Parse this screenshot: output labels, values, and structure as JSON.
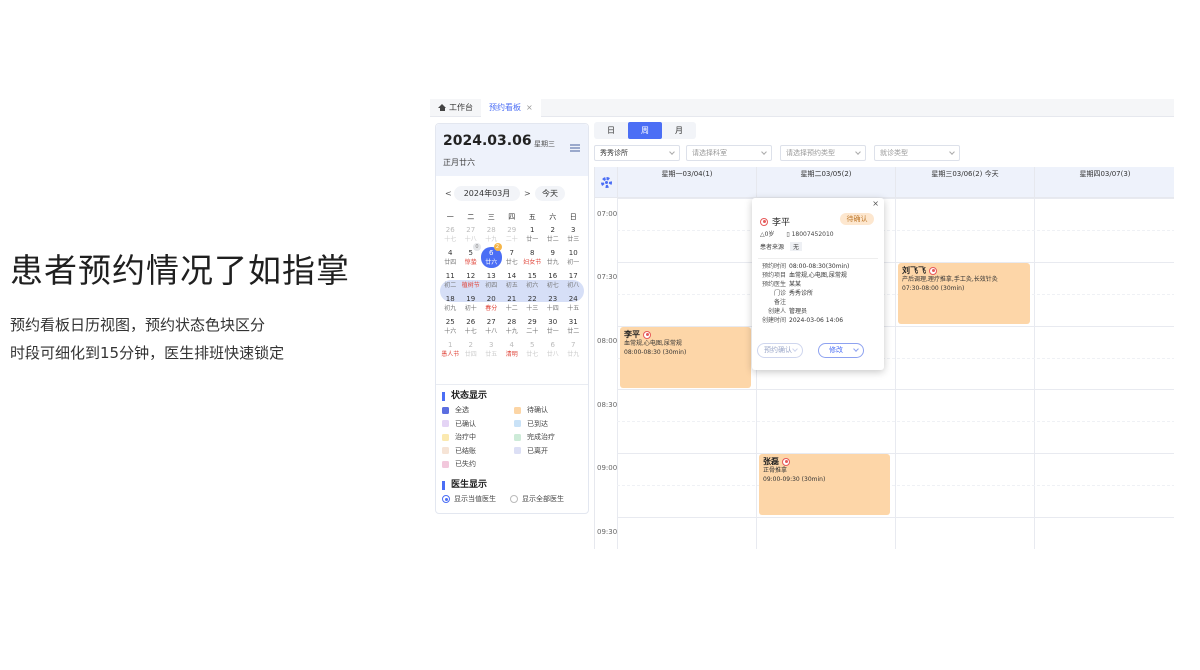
{
  "hero": {
    "title": "患者预约情况了如指掌",
    "line1": "预约看板日历视图，预约状态色块区分",
    "line2": "时段可细化到15分钟，医生排班快速锁定"
  },
  "tabs": [
    {
      "label": "工作台",
      "icon": "home-icon"
    },
    {
      "label": "预约看板",
      "close": "×"
    }
  ],
  "side": {
    "date": "2024.03.06",
    "weekday": "星期三",
    "lunar": "正月廿六",
    "month": "2024年03月",
    "prev": "<",
    "next": ">",
    "today": "今天",
    "week_heads": [
      "一",
      "二",
      "三",
      "四",
      "五",
      "六",
      "日"
    ],
    "weeks": [
      [
        {
          "n": "26",
          "s": "十七",
          "dim": true
        },
        {
          "n": "27",
          "s": "十八",
          "dim": true
        },
        {
          "n": "28",
          "s": "十九",
          "dim": true
        },
        {
          "n": "29",
          "s": "二十",
          "dim": true
        },
        {
          "n": "1",
          "s": "廿一"
        },
        {
          "n": "2",
          "s": "廿二"
        },
        {
          "n": "3",
          "s": "廿三"
        }
      ],
      [
        {
          "n": "4",
          "s": "廿四"
        },
        {
          "n": "5",
          "s": "惊蛰",
          "red": true,
          "badge": "0"
        },
        {
          "n": "6",
          "s": "廿六",
          "selected": true,
          "badge": "2"
        },
        {
          "n": "7",
          "s": "廿七"
        },
        {
          "n": "8",
          "s": "妇女节",
          "red": true
        },
        {
          "n": "9",
          "s": "廿九"
        },
        {
          "n": "10",
          "s": "初一"
        }
      ],
      [
        {
          "n": "11",
          "s": "初二"
        },
        {
          "n": "12",
          "s": "植树节",
          "red": true
        },
        {
          "n": "13",
          "s": "初四"
        },
        {
          "n": "14",
          "s": "初五"
        },
        {
          "n": "15",
          "s": "初六"
        },
        {
          "n": "16",
          "s": "初七"
        },
        {
          "n": "17",
          "s": "初八"
        }
      ],
      [
        {
          "n": "18",
          "s": "初九"
        },
        {
          "n": "19",
          "s": "初十"
        },
        {
          "n": "20",
          "s": "春分",
          "red": true
        },
        {
          "n": "21",
          "s": "十二"
        },
        {
          "n": "22",
          "s": "十三"
        },
        {
          "n": "23",
          "s": "十四"
        },
        {
          "n": "24",
          "s": "十五"
        }
      ],
      [
        {
          "n": "25",
          "s": "十六"
        },
        {
          "n": "26",
          "s": "十七"
        },
        {
          "n": "27",
          "s": "十八"
        },
        {
          "n": "28",
          "s": "十九"
        },
        {
          "n": "29",
          "s": "二十"
        },
        {
          "n": "30",
          "s": "廿一"
        },
        {
          "n": "31",
          "s": "廿二"
        }
      ],
      [
        {
          "n": "1",
          "s": "愚人节",
          "dim": true,
          "red": true
        },
        {
          "n": "2",
          "s": "廿四",
          "dim": true
        },
        {
          "n": "3",
          "s": "廿五",
          "dim": true
        },
        {
          "n": "4",
          "s": "清明",
          "dim": true,
          "red": true
        },
        {
          "n": "5",
          "s": "廿七",
          "dim": true
        },
        {
          "n": "6",
          "s": "廿八",
          "dim": true
        },
        {
          "n": "7",
          "s": "廿九",
          "dim": true
        }
      ]
    ],
    "status_title": "状态显示",
    "statuses": [
      {
        "label": "全选",
        "color": "#5b6ee0"
      },
      {
        "label": "待确认",
        "color": "#fcd5a5"
      },
      {
        "label": "已确认",
        "color": "#e4d4f5"
      },
      {
        "label": "已到达",
        "color": "#c9e2f7"
      },
      {
        "label": "治疗中",
        "color": "#fbe9b0"
      },
      {
        "label": "完成治疗",
        "color": "#cdebd8"
      },
      {
        "label": "已结账",
        "color": "#f6e4d6"
      },
      {
        "label": "已离开",
        "color": "#dcdff5"
      },
      {
        "label": "已失约",
        "color": "#f2c8dc"
      }
    ],
    "doctor_title": "医生显示",
    "doctor_opts": [
      "显示当值医生",
      "显示全部医生"
    ]
  },
  "views": [
    "日",
    "周",
    "月"
  ],
  "filters": {
    "clinic": "秀秀诊所",
    "dept": "请选择科室",
    "type": "请选择预约类型",
    "visit": "就诊类型"
  },
  "week": {
    "days": [
      "星期一03/04(1)",
      "星期二03/05(2)",
      "星期三03/06(2) 今天",
      "星期四03/07(3)"
    ],
    "times": [
      "07:00",
      "07:30",
      "08:00",
      "08:30",
      "09:00",
      "09:30"
    ]
  },
  "appointments": [
    {
      "name": "李平",
      "desc": "血常规,心电图,尿常规",
      "time": "08:00-08:30 (30min)"
    },
    {
      "name": "刘飞飞",
      "desc": "产后调理,理疗推拿,手工灸,长效针灸",
      "time": "07:30-08:00 (30min)"
    },
    {
      "name": "张磊",
      "desc": "正骨推拿",
      "time": "09:00-09:30 (30min)"
    }
  ],
  "popup": {
    "close": "×",
    "name": "李平",
    "status": "待确认",
    "age": "△0岁",
    "phone": "18007452010",
    "source_label": "患者来源",
    "source": "无",
    "fields": [
      {
        "k": "预约时间",
        "v": "08:00-08:30(30min)"
      },
      {
        "k": "预约项目",
        "v": "血常规,心电图,尿常规"
      },
      {
        "k": "预约医生",
        "v": "某某"
      },
      {
        "k": "门诊",
        "v": "秀秀诊所"
      },
      {
        "k": "备注",
        "v": ""
      },
      {
        "k": "创建人",
        "v": "管理员"
      },
      {
        "k": "创建时间",
        "v": "2024-03-06 14:06"
      }
    ],
    "btn_status": "预约确认",
    "btn_edit": "修改"
  }
}
